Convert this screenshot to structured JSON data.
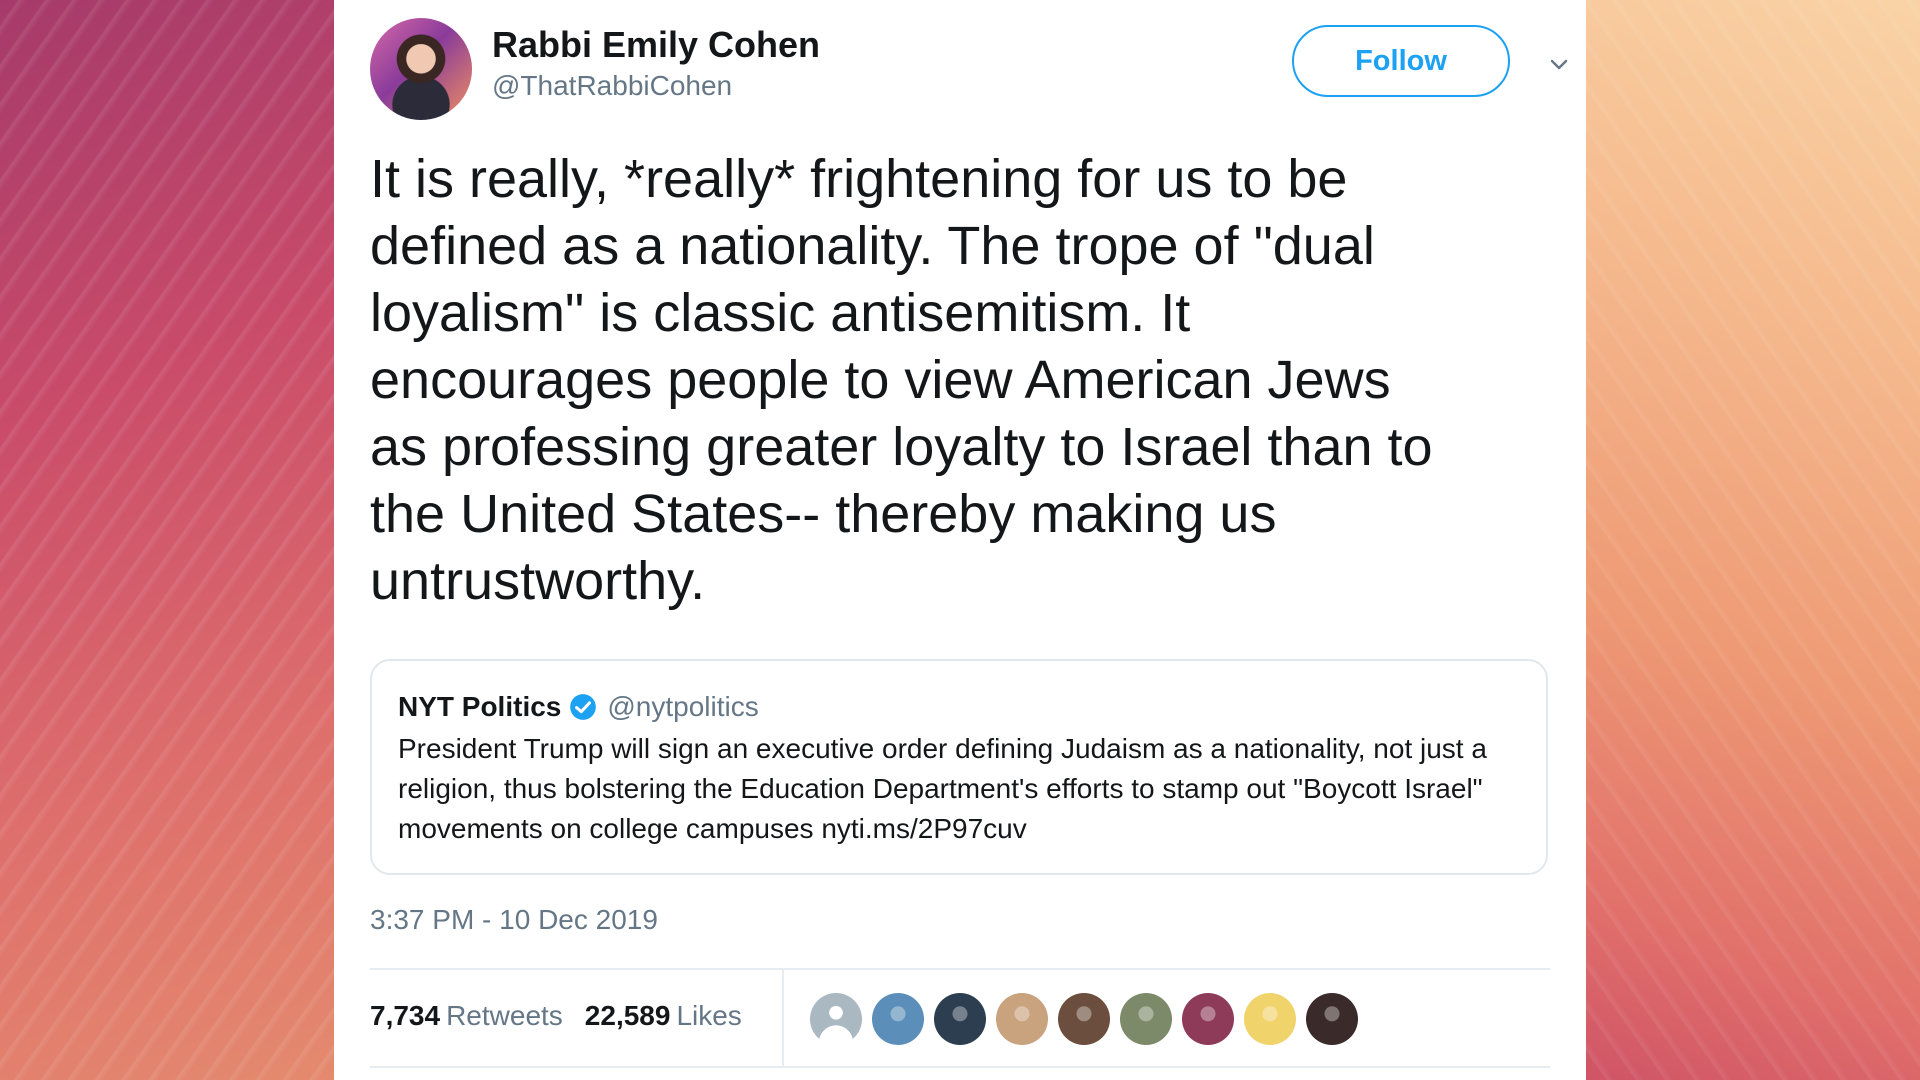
{
  "tweet": {
    "author": {
      "name": "Rabbi Emily Cohen",
      "handle": "@ThatRabbiCohen"
    },
    "follow_label": "Follow",
    "text": "It is really, *really* frightening for us to be\ndefined as a nationality. The trope of \"dual\nloyalism\" is classic antisemitism. It\nencourages people to view American Jews\nas professing greater loyalty to Israel than to\nthe United States-- thereby making us\nuntrustworthy.",
    "quoted": {
      "name": "NYT Politics",
      "handle": "@nytpolitics",
      "verified": true,
      "text": "President Trump will sign an executive order defining Judaism as a nationality, not just a religion, thus bolstering the Education Department's efforts to stamp out \"Boycott Israel\" movements on college campuses nyti.ms/2P97cuv"
    },
    "timestamp": "3:37 PM - 10 Dec 2019",
    "stats": {
      "retweets_count": "7,734",
      "retweets_label": "Retweets",
      "likes_count": "22,589",
      "likes_label": "Likes"
    },
    "likers": [
      {
        "icon": "default-avatar",
        "color": "#aab8c2"
      },
      {
        "icon": "avatar",
        "color": "#5b8fb9"
      },
      {
        "icon": "avatar",
        "color": "#2c3e50"
      },
      {
        "icon": "avatar",
        "color": "#c9a27e"
      },
      {
        "icon": "avatar",
        "color": "#6b4e3d"
      },
      {
        "icon": "avatar",
        "color": "#7d8a6a"
      },
      {
        "icon": "avatar",
        "color": "#8e3b5a"
      },
      {
        "icon": "avatar",
        "color": "#f1d36b"
      },
      {
        "icon": "avatar",
        "color": "#3b2a2a"
      }
    ]
  },
  "colors": {
    "accent": "#1da1f2",
    "text_primary": "#14171a",
    "text_secondary": "#657786",
    "border": "#e1e8ed"
  }
}
